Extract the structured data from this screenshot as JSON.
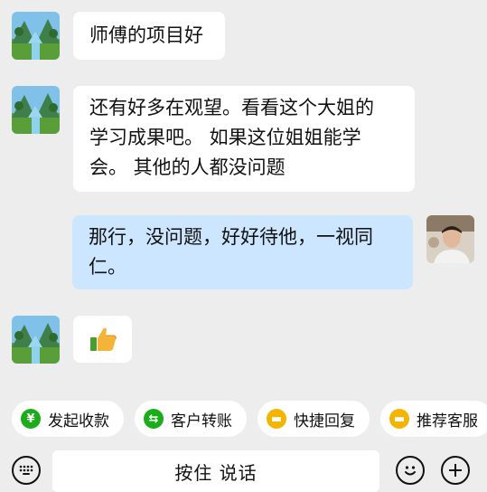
{
  "messages": [
    {
      "side": "in",
      "text": "师傅的项目好"
    },
    {
      "side": "in",
      "text": "还有好多在观望。看看这个大姐的\n学习成果吧。 如果这位姐姐能学\n会。 其他的人都没问题"
    },
    {
      "side": "out",
      "text": "那行，没问题，好好待他，一视同\n仁。"
    },
    {
      "side": "in",
      "emoji": "thumbs-up-icon"
    }
  ],
  "quick_actions": [
    {
      "label": "发起收款",
      "icon": "yen-icon",
      "color": "#1aad19"
    },
    {
      "label": "客户转账",
      "icon": "transfer-icon",
      "color": "#1aad19"
    },
    {
      "label": "快捷回复",
      "icon": "chat-icon",
      "color": "#f5b400"
    },
    {
      "label": "推荐客服",
      "icon": "chat-icon",
      "color": "#f5b400"
    }
  ],
  "input": {
    "hold_to_talk": "按住 说话"
  },
  "colors": {
    "incoming_bubble": "#ffffff",
    "outgoing_bubble": "#cde6ff",
    "background": "#ededed"
  }
}
